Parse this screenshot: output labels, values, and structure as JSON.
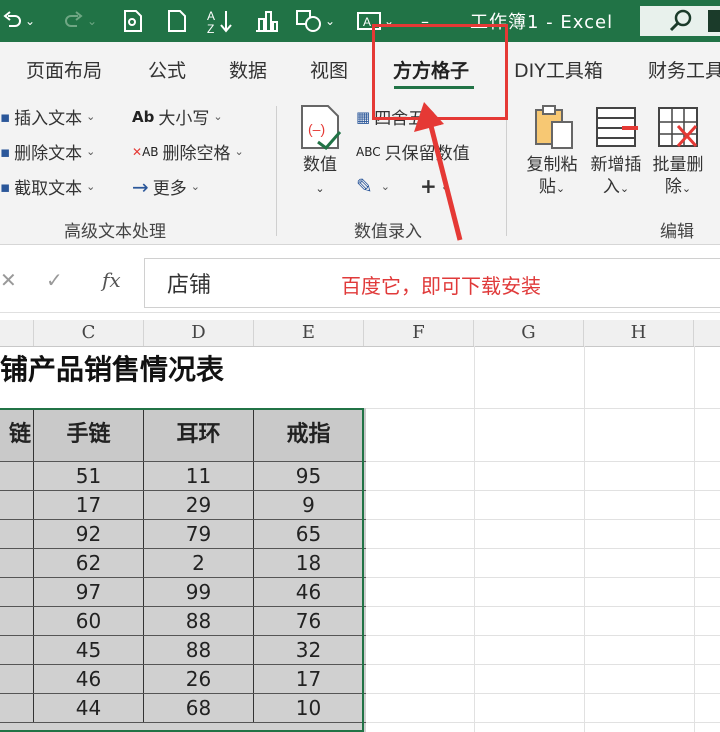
{
  "titlebar": {
    "title": "工作簿1 - Excel",
    "search_icon": "search-icon",
    "undo_icon": "undo-icon",
    "redo_icon": "redo-icon",
    "minimize_glyph": "–"
  },
  "tabs": [
    "页面布局",
    "公式",
    "数据",
    "视图",
    "方方格子",
    "DIY工具箱",
    "财务工具"
  ],
  "active_tab": "方方格子",
  "ribbon": {
    "text_group": {
      "items": [
        "插入文本",
        "删除文本",
        "截取文本"
      ],
      "case_icon_text": "Ab",
      "case_label": "大小写",
      "space_icon_text": "AB",
      "space_label": "删除空格",
      "more_label": "更多",
      "label": "高级文本处理"
    },
    "value_group": {
      "big_label": "数值",
      "round_label": "四舍五入",
      "keep_icon_text": "ABC",
      "keep_label": "只保留数值",
      "plus_glyph": "+",
      "label": "数值录入"
    },
    "edit_group": {
      "copy_label_1": "复制粘",
      "copy_label_2": "贴",
      "insert_label_1": "新增插",
      "insert_label_2": "入",
      "delete_label_1": "批量删",
      "delete_label_2": "除",
      "label": "编辑"
    }
  },
  "formula_bar": {
    "cancel_glyph": "✕",
    "confirm_glyph": "✓",
    "fx_label": "fx",
    "value": "店铺"
  },
  "annotation_text": "百度它，即可下载安装",
  "columns": [
    "C",
    "D",
    "E",
    "F",
    "G",
    "H"
  ],
  "sheet": {
    "title": "铺产品销售情况表",
    "headers": [
      "手链",
      "耳环",
      "戒指"
    ],
    "partial_header": "链",
    "rows": [
      [
        51,
        11,
        95
      ],
      [
        17,
        29,
        9
      ],
      [
        92,
        79,
        65
      ],
      [
        62,
        2,
        18
      ],
      [
        97,
        99,
        46
      ],
      [
        60,
        88,
        76
      ],
      [
        45,
        88,
        32
      ],
      [
        46,
        26,
        17
      ],
      [
        44,
        68,
        10
      ]
    ]
  },
  "colors": {
    "brand_green": "#217346",
    "highlight_red": "#e53935",
    "annotation_red": "#e03a3a",
    "table_fill": "#d0d0d0"
  }
}
